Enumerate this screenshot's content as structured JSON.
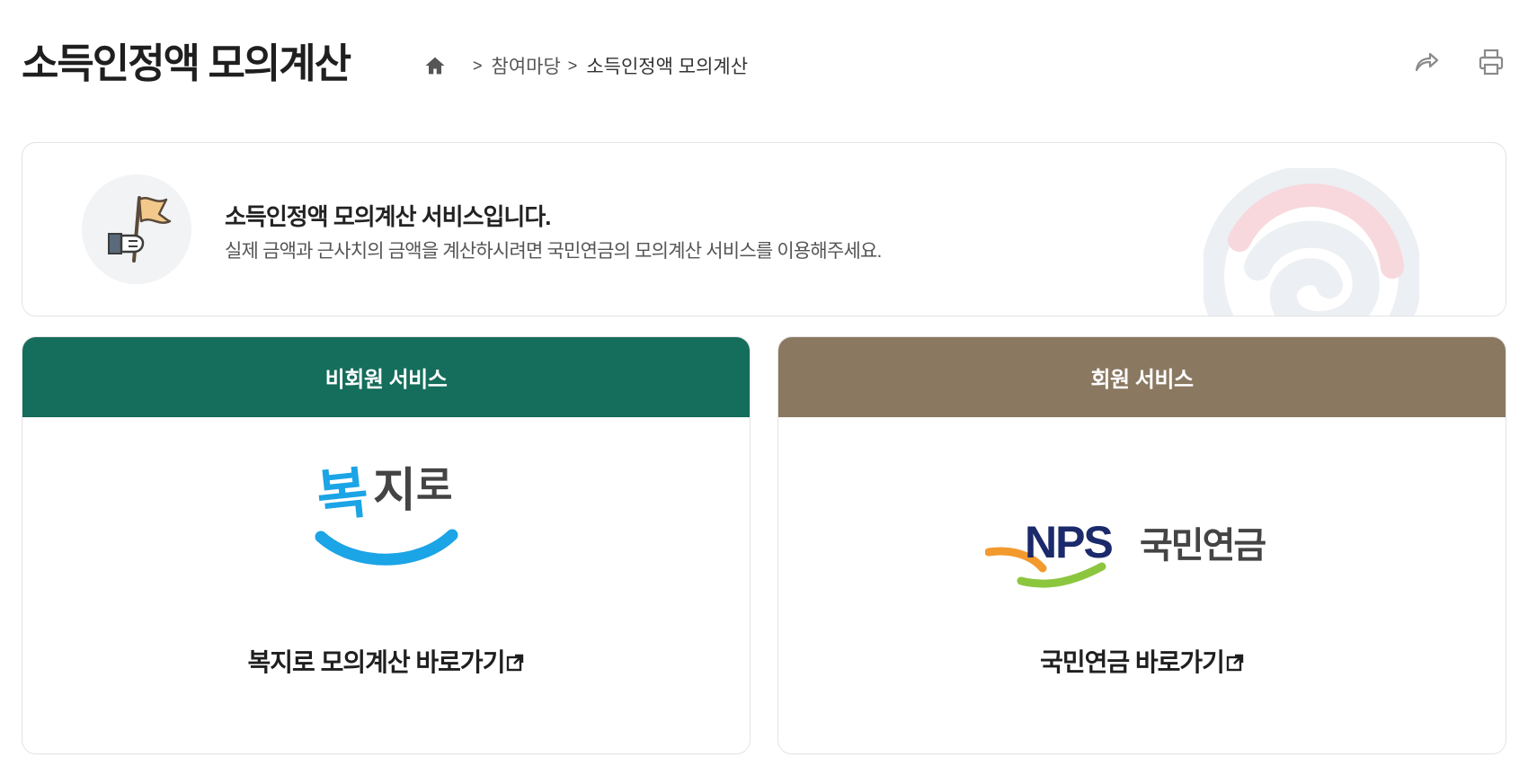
{
  "header": {
    "title": "소득인정액 모의계산",
    "breadcrumb": {
      "home_icon": "home-icon",
      "items": [
        "참여마당",
        "소득인정액 모의계산"
      ]
    },
    "actions": [
      {
        "icon": "share-icon"
      },
      {
        "icon": "print-icon"
      }
    ]
  },
  "intro": {
    "icon": "flag-hand-icon",
    "heading": "소득인정액 모의계산 서비스입니다.",
    "description": "실제 금액과 근사치의 금액을 계산하시려면 국민연금의 모의계산 서비스를 이용해주세요.",
    "emblem": "taegeuk-emblem-icon"
  },
  "services": [
    {
      "header": "비회원 서비스",
      "logo_text": "복지로",
      "link_label": "복지로 모의계산 바로가기",
      "link_icon": "external-link-icon",
      "header_color": "#156d5b"
    },
    {
      "header": "회원 서비스",
      "logo_text": "NPS 국민연금",
      "link_label": "국민연금 바로가기",
      "link_icon": "external-link-icon",
      "header_color": "#8a7861"
    }
  ],
  "colors": {
    "primary_green": "#156d5b",
    "member_brown": "#8a7861",
    "bokjiro_blue": "#1ba4e6",
    "nps_navy": "#1b2a6b"
  }
}
